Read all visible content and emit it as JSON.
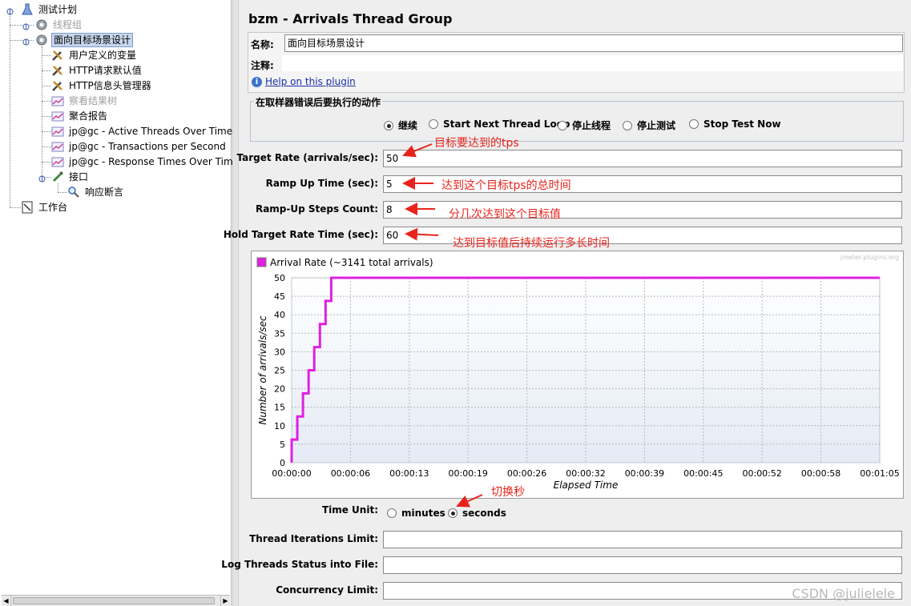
{
  "tree": {
    "items": [
      {
        "label": "测试计划",
        "icon": "flask-icon"
      },
      {
        "label": "线程组",
        "icon": "gear-icon"
      },
      {
        "label": "面向目标场景设计",
        "icon": "gear-icon"
      },
      {
        "label": "用户定义的变量",
        "icon": "wrench-icon"
      },
      {
        "label": "HTTP请求默认值",
        "icon": "wrench-icon"
      },
      {
        "label": "HTTP信息头管理器",
        "icon": "wrench-icon"
      },
      {
        "label": "察看结果树",
        "icon": "chart-icon"
      },
      {
        "label": "聚合报告",
        "icon": "chart-icon"
      },
      {
        "label": "jp@gc - Active Threads Over Time",
        "icon": "chart-icon"
      },
      {
        "label": "jp@gc - Transactions per Second",
        "icon": "chart-icon"
      },
      {
        "label": "jp@gc - Response Times Over Time",
        "icon": "chart-icon"
      },
      {
        "label": "接口",
        "icon": "pipette-icon"
      },
      {
        "label": "响应断言",
        "icon": "magnifier-icon"
      },
      {
        "label": "工作台",
        "icon": "workbench-icon"
      }
    ]
  },
  "panel": {
    "title": "bzm - Arrivals Thread Group",
    "name_label": "名称:",
    "name_value": "面向目标场景设计",
    "comment_label": "注释:",
    "comment_value": "",
    "help_link": "Help on this plugin",
    "on_error_title": "在取样器错误后要执行的动作",
    "on_error_options": [
      "继续",
      "Start Next Thread Loop",
      "停止线程",
      "停止测试",
      "Stop Test Now"
    ],
    "on_error_selected": 0,
    "target_rate_label": "Target Rate (arrivals/sec):",
    "target_rate_value": "50",
    "ramp_up_label": "Ramp Up Time (sec):",
    "ramp_up_value": "5",
    "steps_label": "Ramp-Up Steps Count:",
    "steps_value": "8",
    "hold_label": "Hold Target Rate Time (sec):",
    "hold_value": "60",
    "time_unit_label": "Time Unit:",
    "time_unit_options": [
      "minutes",
      "seconds"
    ],
    "time_unit_selected": 1,
    "iterations_label": "Thread Iterations Limit:",
    "iterations_value": "",
    "log_label": "Log Threads Status into File:",
    "log_value": "",
    "concurrency_label": "Concurrency Limit:",
    "concurrency_value": ""
  },
  "annotations": {
    "target_rate": "目标要达到的tps",
    "ramp_up": "达到这个目标tps的总时间",
    "steps": "分几次达到这个目标值",
    "hold": "达到目标值后持续运行多长时间",
    "time_unit": "切换秒",
    "color": "#e8231b"
  },
  "watermark": "CSDN @julielele",
  "chart_data": {
    "type": "line",
    "legend": "Arrival Rate (~3141 total arrivals)",
    "brand": "jmeter-plugins.org",
    "xlabel": "Elapsed Time",
    "ylabel": "Number of arrivals/sec",
    "x_ticks": [
      "00:00:00",
      "00:00:06",
      "00:00:13",
      "00:00:19",
      "00:00:26",
      "00:00:32",
      "00:00:39",
      "00:00:45",
      "00:00:52",
      "00:00:58",
      "00:01:05"
    ],
    "y_ticks": [
      "0",
      "5",
      "10",
      "15",
      "20",
      "25",
      "30",
      "35",
      "40",
      "45",
      "50"
    ],
    "ylim": [
      0,
      50
    ],
    "xlim": [
      0,
      65
    ],
    "series_color": "#e020e0",
    "series": [
      {
        "x": [
          0,
          0,
          0.625,
          0.625,
          1.25,
          1.25,
          1.875,
          1.875,
          2.5,
          2.5,
          3.125,
          3.125,
          3.75,
          3.75,
          4.375,
          4.375,
          5,
          65
        ],
        "y": [
          0,
          6.25,
          6.25,
          12.5,
          12.5,
          18.75,
          18.75,
          25,
          25,
          31.25,
          31.25,
          37.5,
          37.5,
          43.75,
          43.75,
          50,
          50,
          50
        ]
      }
    ]
  }
}
